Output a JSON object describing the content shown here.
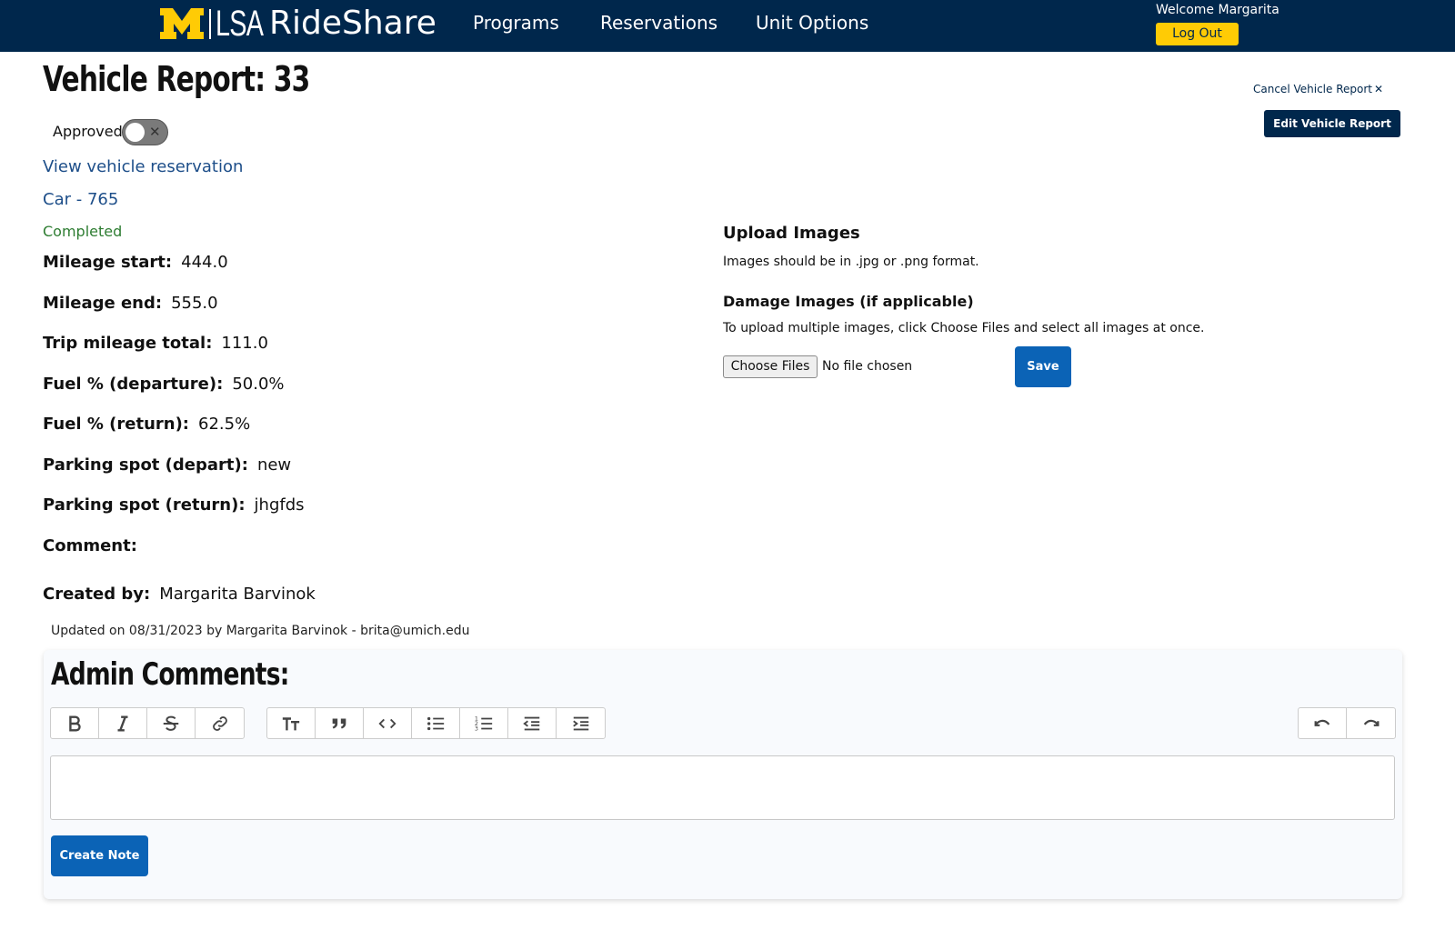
{
  "header": {
    "logo_text": "LSA",
    "brand": "RideShare",
    "nav": [
      "Programs",
      "Reservations",
      "Unit Options"
    ],
    "welcome": "Welcome Margarita",
    "logout_label": "Log Out"
  },
  "report": {
    "title": "Vehicle Report: 33",
    "cancel_label": "Cancel Vehicle Report",
    "cancel_icon": "✕",
    "edit_label": "Edit Vehicle Report",
    "approved_label": "Approved",
    "approved": false,
    "view_reservation_link": "View vehicle reservation",
    "car_link": "Car - 765",
    "status": "Completed",
    "fields": [
      {
        "label": "Mileage start:",
        "value": "444.0"
      },
      {
        "label": "Mileage end:",
        "value": "555.0"
      },
      {
        "label": "Trip mileage total:",
        "value": "111.0"
      },
      {
        "label": "Fuel % (departure):",
        "value": "50.0%"
      },
      {
        "label": "Fuel % (return):",
        "value": "62.5%"
      },
      {
        "label": "Parking spot (depart):",
        "value": "new"
      },
      {
        "label": "Parking spot (return):",
        "value": "jhgfds"
      },
      {
        "label": "Comment:",
        "value": ""
      },
      {
        "label": "Created by:",
        "value": "Margarita Barvinok"
      }
    ],
    "updated": "Updated on 08/31/2023 by Margarita Barvinok - brita@umich.edu"
  },
  "upload": {
    "heading": "Upload Images",
    "note": "Images should be in .jpg or .png format.",
    "damage_heading": "Damage Images (if applicable)",
    "damage_note": "To upload multiple images, click Choose Files and select all images at once.",
    "choose_label": "Choose Files",
    "no_file": "No file chosen",
    "save_label": "Save"
  },
  "admin": {
    "title": "Admin Comments:",
    "toolbar_left": [
      "bold-icon",
      "italic-icon",
      "strikethrough-icon",
      "link-icon"
    ],
    "toolbar_mid": [
      "heading-icon",
      "quote-icon",
      "code-icon",
      "bullet-list-icon",
      "numbered-list-icon",
      "outdent-icon",
      "indent-icon"
    ],
    "toolbar_right": [
      "undo-icon",
      "redo-icon"
    ],
    "create_label": "Create Note"
  },
  "colors": {
    "navy": "#00274c",
    "maize": "#ffcb05",
    "primary_blue": "#0b63b6",
    "link_blue": "#1d4e89",
    "status_green": "#2e7d32"
  }
}
